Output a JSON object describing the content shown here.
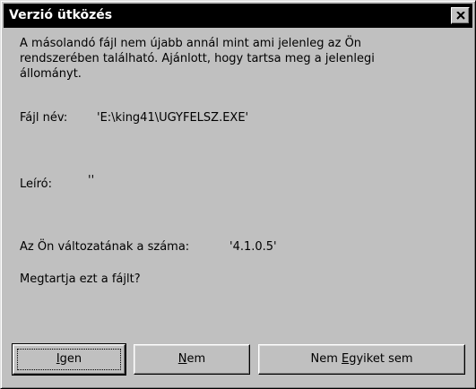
{
  "dialog": {
    "title": "Verzió ütközés",
    "close_symbol": "close-x-icon",
    "message_lines": [
      "A másolandó fájl nem újabb annál mint ami jelenleg az Ön",
      "rendszerében található. Ajánlott, hogy tartsa meg a jelenlegi",
      "állományt."
    ],
    "file_name_label": "Fájl név:",
    "file_name_value": "'E:\\king41\\UGYFELSZ.EXE'",
    "description_label": "Leíró:",
    "description_value": "''",
    "version_label": "Az Ön változatának a száma:",
    "version_value": "'4.1.0.5'",
    "question": "Megtartja ezt a fájlt?",
    "buttons": {
      "yes": {
        "label_accel": "I",
        "label_rest": "gen"
      },
      "no": {
        "label_accel": "N",
        "label_rest": "em"
      },
      "none": {
        "label_pre": "Nem ",
        "label_accel": "E",
        "label_rest": "gyiket sem"
      }
    }
  },
  "colors": {
    "face": "#c0c0c0",
    "titlebar": "#000000",
    "title_text": "#ffffff"
  }
}
